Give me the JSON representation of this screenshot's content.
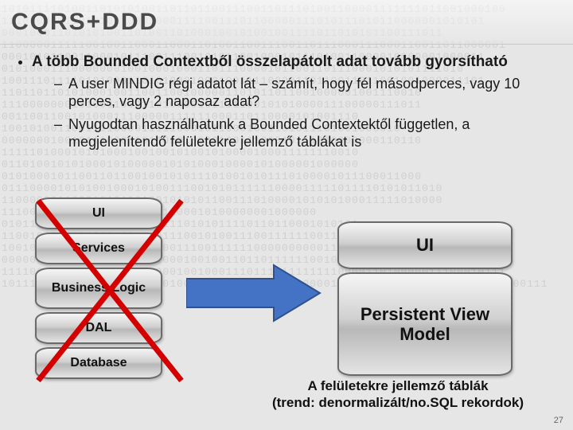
{
  "title": "CQRS+DDD",
  "bullets": {
    "main": "A több Bounded Contextből összelapátolt adat tovább gyorsítható",
    "sub1": "A user MINDIG régi adatot lát – számít, hogy fél másodperces, vagy 10 perces, vagy 2 naposaz adat?",
    "sub2": "Nyugodtan használhatunk a Bounded Contextektől független, a megjelenítendő felületekre jellemző táblákat is"
  },
  "left_stack": {
    "l1": "UI",
    "l2": "Services",
    "l3": "Business Logic",
    "l4": "DAL",
    "l5": "Database"
  },
  "right_stack": {
    "r1": "UI",
    "r2": "Persistent View Model"
  },
  "caption": {
    "line1": "A felületekre jellemző táblák",
    "line2": "(trend: denormalizált/no.SQL rekordok)"
  },
  "page_number": "27",
  "binary_filler": "101011110100110101010011011011001110011011101001100001111111011001000100\n111000000110101001000100011110011101100000111010111010110000001010101\n000100011010101001101001101000100101001001111011010101100111011\n110000011111001001100011000110100110011100110111000111000110011011000001\n000101011001100010111001110010101100100010111010011000010000001000011\n010100011100000001001000100011011100001011001101110001010101111010\n100111011110101000110101000100010011110000110110011011001001000011101\n110110110101000100110011001000001101011011001000001001110010\n111000000010100010001101000010111110010101000011100000111011\n001100110010100011100000111111000110110000101001110\n100101001100111100001111100010110001001101011101001000010\n000000010010111000010110101000010011100010111010000000110110\n111110100010101000100100101001010000100011111110010\n011010010101000101000001010100010000101000001000000\n010100010110011011001001010111010010101110100001011100011000\n011100001010100100010100111001010111111000011111011110101011010\n110000001100010101001001010101100111010000101010100011111010000\n111000001000100100000111100010100000001000000\n010110010001100001110101110101011110110110001010101\n110010100100100010011101110010100111001111110011000010101\n100101000110110001110100011100111111000000000011011100100110000\n000000110011001001100110001001001101101111110010100011001101\n111100101011011010110100010010001110111011111111000011010000011100010111\n101111101001011010101010100101011101010011000001110010001011110110100001100111"
}
